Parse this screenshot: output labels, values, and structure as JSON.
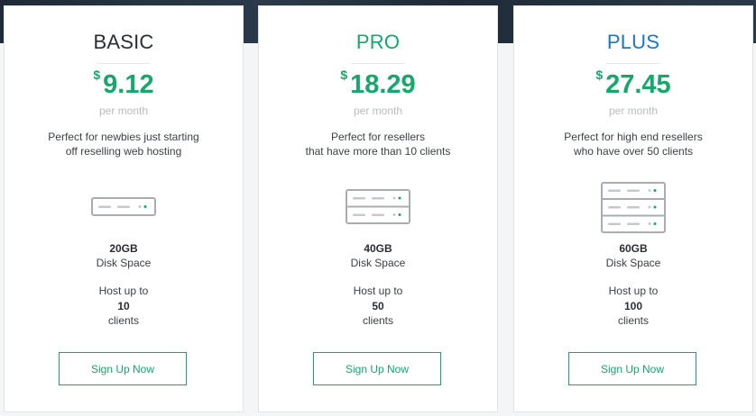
{
  "plans": [
    {
      "name": "BASIC",
      "name_color": "#2a2e33",
      "currency": "$",
      "price": "9.12",
      "period": "per month",
      "description": [
        "Perfect for newbies just starting",
        "off reselling web hosting"
      ],
      "server_icon": "server-1-unit-icon",
      "disk_size": "20GB",
      "disk_label": "Disk Space",
      "host_label": "Host up to",
      "host_count": "10",
      "host_unit": "clients",
      "button_label": "Sign Up Now"
    },
    {
      "name": "PRO",
      "name_color": "#14a86a",
      "currency": "$",
      "price": "18.29",
      "period": "per month",
      "description": [
        "Perfect for resellers",
        "that have more than 10 clients"
      ],
      "server_icon": "server-2-unit-icon",
      "disk_size": "40GB",
      "disk_label": "Disk Space",
      "host_label": "Host up to",
      "host_count": "50",
      "host_unit": "clients",
      "button_label": "Sign Up Now"
    },
    {
      "name": "PLUS",
      "name_color": "#1a78c2",
      "currency": "$",
      "price": "27.45",
      "period": "per month",
      "description": [
        "Perfect for high end resellers",
        "who have over 50 clients"
      ],
      "server_icon": "server-3-unit-icon",
      "disk_size": "60GB",
      "disk_label": "Disk Space",
      "host_label": "Host up to",
      "host_count": "100",
      "host_unit": "clients",
      "button_label": "Sign Up Now"
    }
  ],
  "colors": {
    "accent": "#14a86a",
    "plus_blue": "#1a78c2",
    "muted": "#b8bcc0",
    "text": "#3b3f44"
  }
}
